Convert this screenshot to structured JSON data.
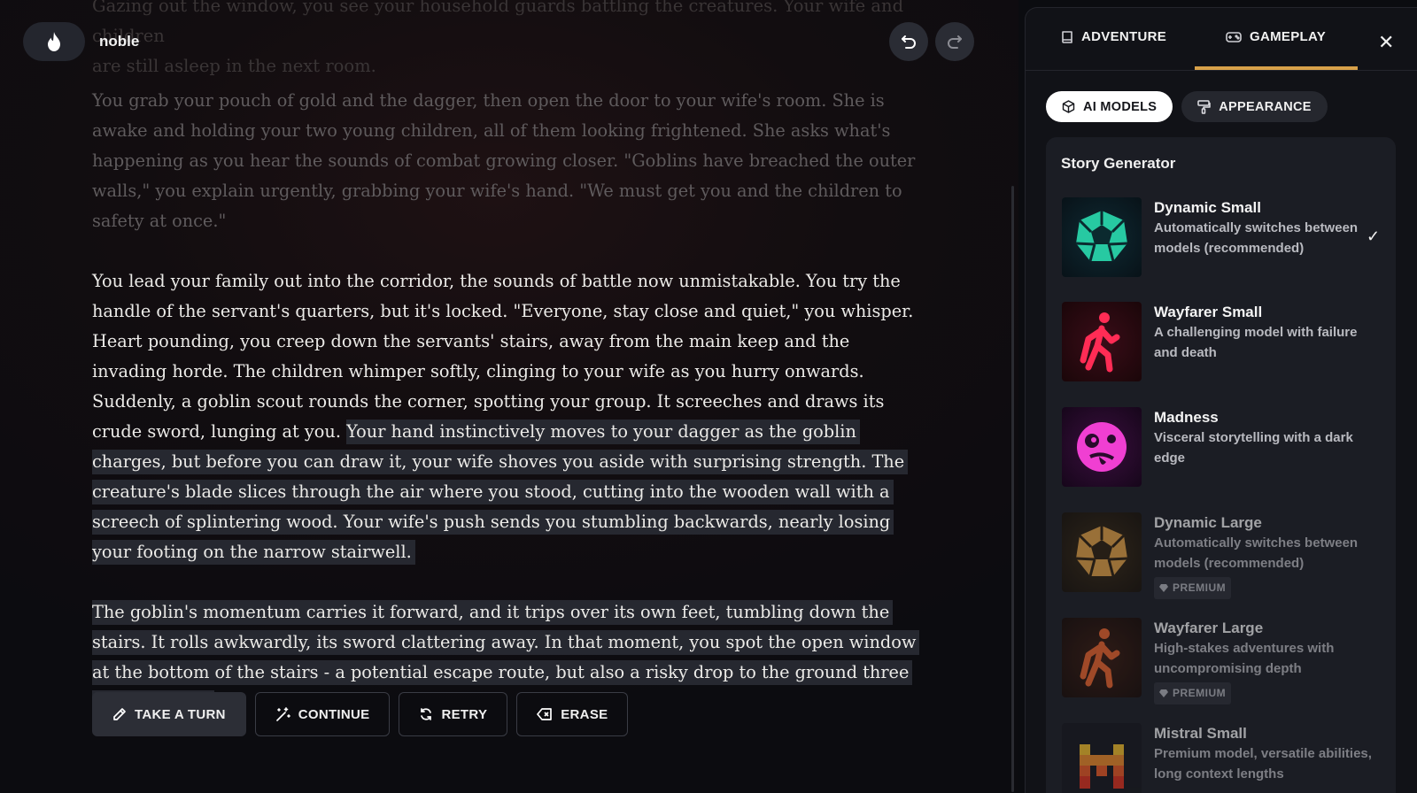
{
  "app": {
    "username": "noble"
  },
  "story": {
    "top_fade_lines": [
      "Gazing out the window, you see your household guards battling the creatures. Your wife and children",
      "are still asleep in the next room."
    ],
    "paragraph_faded": "You grab your pouch of gold and the dagger, then open the door to your wife's room. She is awake and holding your two young children, all of them looking frightened. She asks what's happening as you hear the sounds of combat growing closer. \"Goblins have breached the outer walls,\" you explain urgently, grabbing your wife's hand. \"We must get you and the children to safety at once.\"",
    "paragraph_1": "You lead your family out into the corridor, the sounds of battle now unmistakable. You try the handle of the servant's quarters, but it's locked. \"Everyone, stay close and quiet,\" you whisper.",
    "paragraph_2": "Heart pounding, you creep down the servants' stairs, away from the main keep and the invading horde. The children whimper softly, clinging to your wife as you hurry onwards.",
    "paragraph_3_plain": "Suddenly, a goblin scout rounds the corner, spotting your group. It screeches and draws its crude sword, lunging at you.",
    "paragraph_3_highlight": "Your hand instinctively moves to your dagger as the goblin charges, but before you can draw it, your wife shoves you aside with surprising strength. The creature's blade slices through the air where you stood, cutting into the wooden wall with a screech of splintering wood. Your wife's push sends you stumbling backwards, nearly losing your footing on the narrow stairwell.",
    "paragraph_4_highlight": "The goblin's momentum carries it forward, and it trips over its own feet, tumbling down the stairs. It rolls awkwardly, its sword clattering away. In that moment, you spot the open window at the bottom of the stairs - a potential escape route, but also a risky drop to the ground three stories below."
  },
  "actions": {
    "take_turn": "TAKE A TURN",
    "continue": "CONTINUE",
    "retry": "RETRY",
    "erase": "ERASE"
  },
  "panel": {
    "tab_adventure": "ADVENTURE",
    "tab_gameplay": "GAMEPLAY",
    "subtab_ai_models": "AI MODELS",
    "subtab_appearance": "APPEARANCE",
    "section_title": "Story Generator",
    "models": [
      {
        "name": "Dynamic Small",
        "desc": "Automatically switches between models (recommended)",
        "selected": true,
        "premium": false,
        "icon": "green-dodecahedron-icon"
      },
      {
        "name": "Wayfarer Small",
        "desc": "A challenging model with failure and death",
        "selected": false,
        "premium": false,
        "icon": "red-hiker-icon"
      },
      {
        "name": "Madness",
        "desc": "Visceral storytelling with a dark edge",
        "selected": false,
        "premium": false,
        "icon": "pink-crazy-face-icon"
      },
      {
        "name": "Dynamic Large",
        "desc": "Automatically switches between models (recommended)",
        "selected": false,
        "premium": true,
        "icon": "gold-dodecahedron-icon"
      },
      {
        "name": "Wayfarer Large",
        "desc": "High-stakes adventures with uncompromising depth",
        "selected": false,
        "premium": true,
        "icon": "orange-hiker-icon"
      },
      {
        "name": "Mistral Small",
        "desc": "Premium model, versatile abilities, long context lengths",
        "selected": false,
        "premium": false,
        "icon": "mistral-logo-icon"
      }
    ],
    "premium_label": "PREMIUM",
    "check_glyph": "✓",
    "close_glyph": "✕"
  },
  "colors": {
    "accent_tab": "#d8a14a",
    "highlight_bg": "#262830"
  }
}
